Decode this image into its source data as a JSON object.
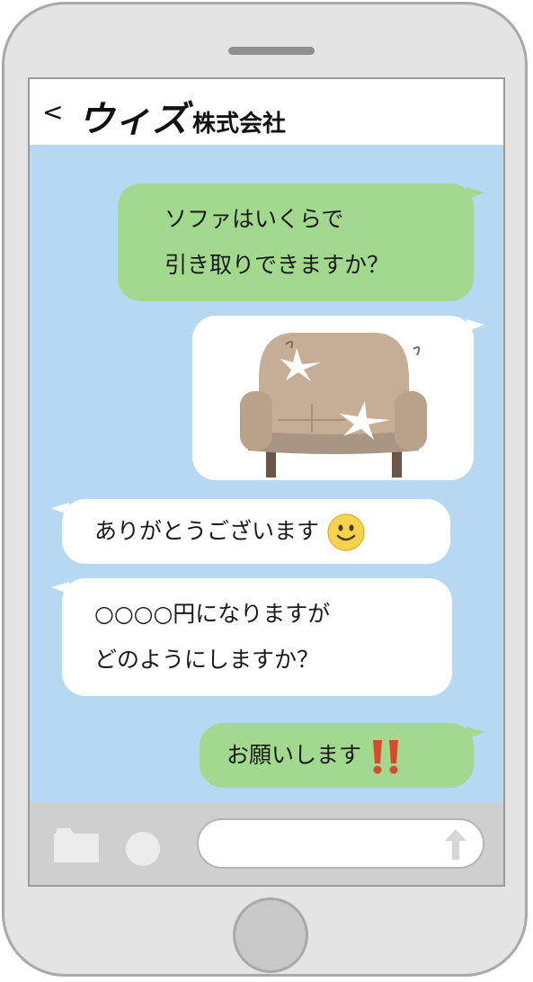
{
  "header": {
    "back_label": "<",
    "title_main": "ウィズ",
    "title_sub": "株式会社"
  },
  "messages": [
    {
      "side": "right",
      "color": "green",
      "lines": [
        "ソファはいくらで",
        "引き取りできますか？"
      ]
    },
    {
      "side": "right",
      "color": "white",
      "type": "image",
      "image": "worn-sofa"
    },
    {
      "side": "left",
      "color": "white",
      "lines": [
        "ありがとうございます"
      ],
      "emoji": "smiling-face"
    },
    {
      "side": "left",
      "color": "white",
      "lines": [
        "○○○○円になりますが",
        "どのようにしますか？"
      ]
    },
    {
      "side": "right",
      "color": "green",
      "lines": [
        "お願いします"
      ],
      "emoji": "double-exclamation"
    }
  ],
  "input_bar": {
    "icons": [
      "folder-icon",
      "circle-icon",
      "send-arrow-icon"
    ],
    "text_value": ""
  },
  "colors": {
    "chat_bg": "#b7d8f2",
    "bubble_green": "#a3d98e",
    "bubble_white": "#ffffff",
    "phone_body": "#e4e4e4"
  }
}
